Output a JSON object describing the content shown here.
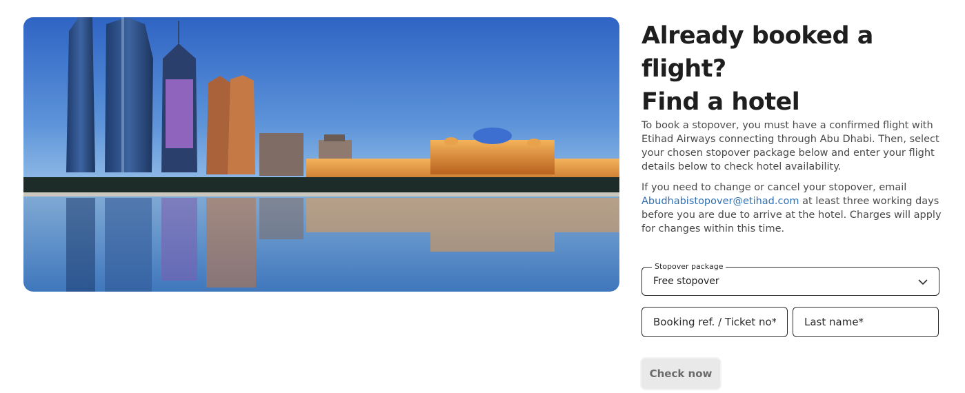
{
  "hero": {
    "image_alt": "Abu Dhabi skyline at dusk reflected in water"
  },
  "heading": {
    "line1": "Already booked a",
    "line2": "flight?",
    "line3": "Find a hotel"
  },
  "intro": "To book a stopover, you must have a confirmed flight with Etihad Airways connecting through Abu Dhabi. Then, select your chosen stopover package below and enter your flight details below to check hotel availability.",
  "change": {
    "before": "If you need to change or cancel your stopover, email ",
    "email": "Abudhabistopover@etihad.com",
    "after": " at least three working days before you are due to arrive at the hotel. Charges will apply for changes within this time."
  },
  "form": {
    "package_label": "Stopover package",
    "package_value": "Free stopover",
    "booking_placeholder": "Booking ref. / Ticket no*",
    "lastname_placeholder": "Last name*",
    "submit_label": "Check now"
  },
  "colors": {
    "link": "#2f6fb3",
    "button_bg": "#e9e9e9",
    "text": "#1e1e1e"
  }
}
